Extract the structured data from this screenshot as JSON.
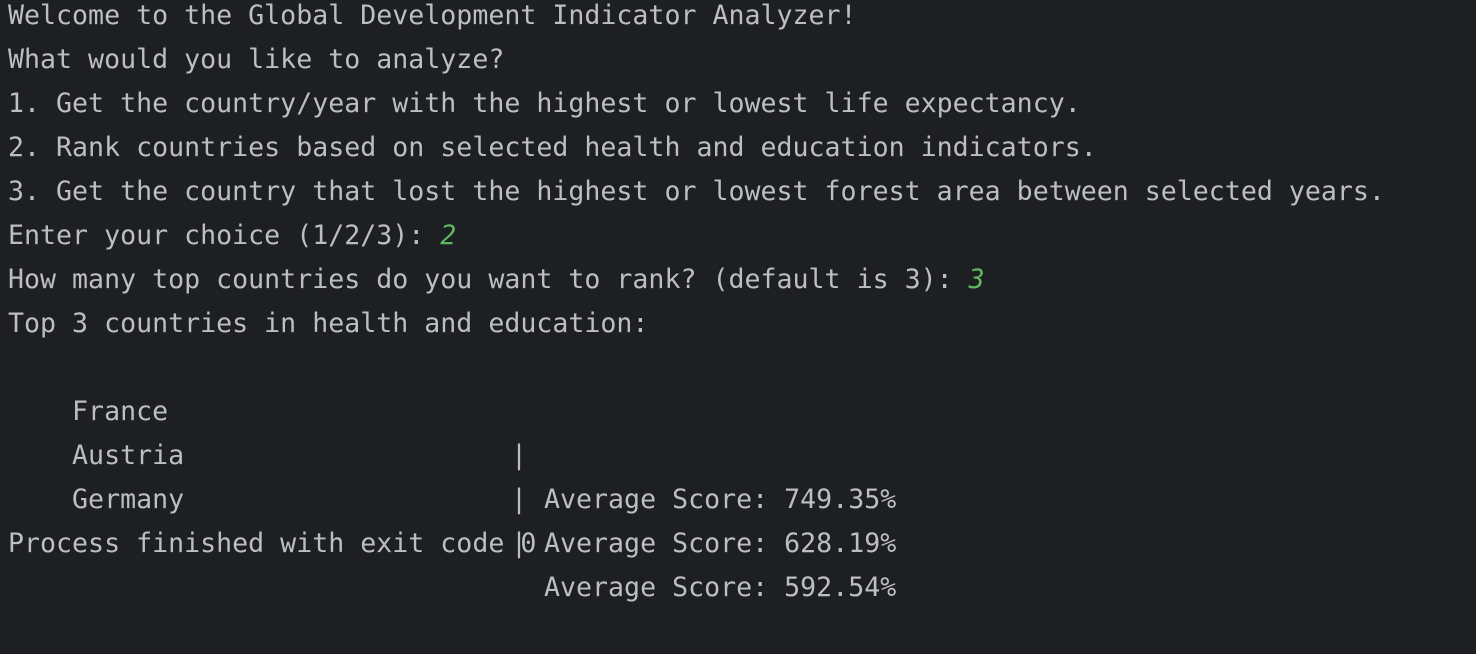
{
  "console": {
    "welcome": "Welcome to the Global Development Indicator Analyzer!",
    "question": "What would you like to analyze?",
    "options": [
      "1. Get the country/year with the highest or lowest life expectancy.",
      "2. Rank countries based on selected health and education indicators.",
      "3. Get the country that lost the highest or lowest forest area between selected years."
    ],
    "choice_prompt": "Enter your choice (1/2/3): ",
    "choice_input": "2",
    "rank_prompt": "How many top countries do you want to rank? (default is 3): ",
    "rank_input": "3",
    "results_header": "Top 3 countries in health and education:",
    "results": [
      {
        "country": "France",
        "separator": "|",
        "score": "Average Score: 749.35%"
      },
      {
        "country": "Austria",
        "separator": "|",
        "score": "Average Score: 628.19%"
      },
      {
        "country": "Germany",
        "separator": "|",
        "score": "Average Score: 592.54%"
      }
    ],
    "exit_message": "Process finished with exit code 0"
  },
  "colors": {
    "background": "#1e1f22",
    "text": "#bcbec4",
    "user_input": "#5fb760"
  }
}
